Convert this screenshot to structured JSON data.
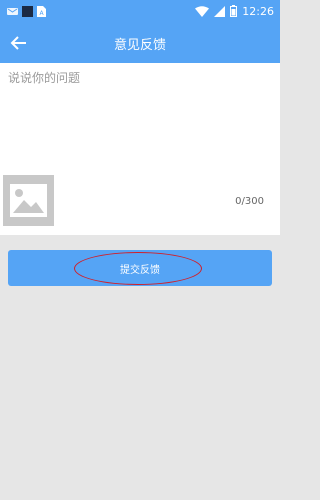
{
  "status_bar": {
    "time": "12:26",
    "icons": [
      "notification-icon",
      "app-square-icon",
      "sim-icon",
      "wifi-icon",
      "signal-icon",
      "battery-icon"
    ]
  },
  "header": {
    "title": "意见反馈",
    "back_icon": "arrow-left-icon"
  },
  "feedback": {
    "placeholder": "说说你的问题",
    "value": "",
    "char_count": "0/300",
    "image_icon": "image-placeholder-icon"
  },
  "actions": {
    "submit_label": "提交反馈"
  },
  "colors": {
    "primary": "#55a4f5",
    "background": "#e6e6e6",
    "panel": "#ffffff",
    "annotation": "#d0202a"
  }
}
